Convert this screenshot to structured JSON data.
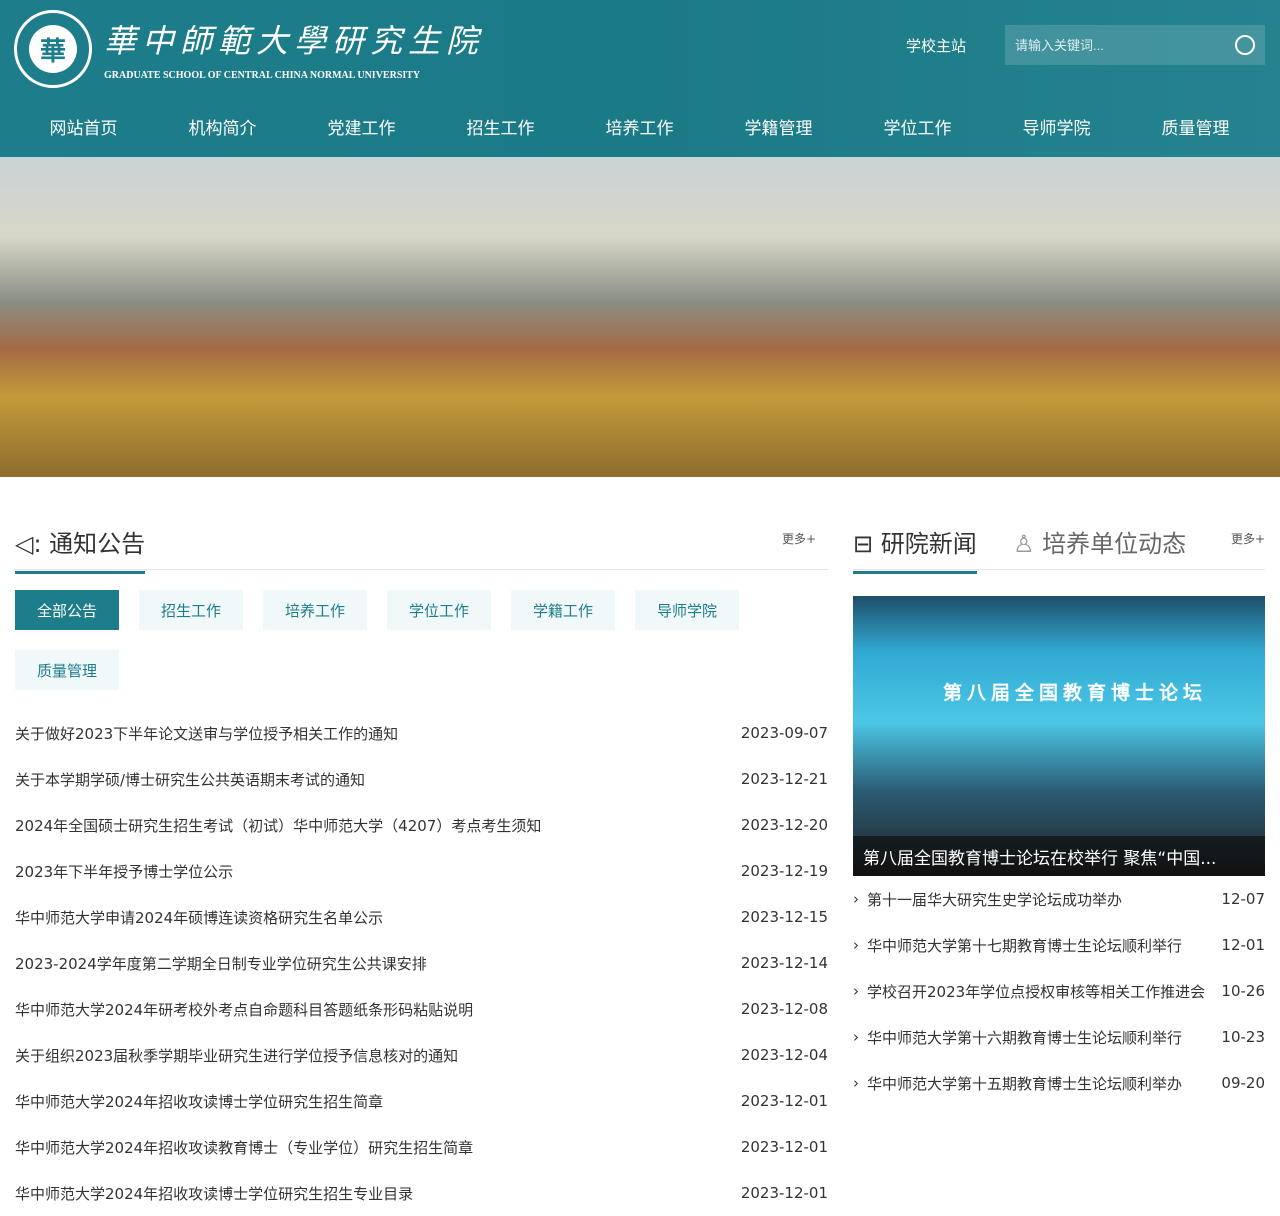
{
  "header": {
    "logo_text": "華",
    "title_cn": "華中師範大學研究生院",
    "title_en": "GRADUATE SCHOOL OF CENTRAL CHINA NORMAL UNIVERSITY",
    "school_link": "学校主站",
    "search_placeholder": "请输入关键词..."
  },
  "nav": [
    "网站首页",
    "机构简介",
    "党建工作",
    "招生工作",
    "培养工作",
    "学籍管理",
    "学位工作",
    "导师学院",
    "质量管理"
  ],
  "banner": {
    "slides": 5,
    "active": 4
  },
  "notices": {
    "title": "通知公告",
    "more": "更多+",
    "tabs": [
      "全部公告",
      "招生工作",
      "培养工作",
      "学位工作",
      "学籍工作",
      "导师学院",
      "质量管理"
    ],
    "items": [
      {
        "t": "关于做好2023下半年论文送审与学位授予相关工作的通知",
        "d": "2023-09-07"
      },
      {
        "t": "关于本学期学硕/博士研究生公共英语期末考试的通知",
        "d": "2023-12-21"
      },
      {
        "t": "2024年全国硕士研究生招生考试（初试）华中师范大学（4207）考点考生须知",
        "d": "2023-12-20"
      },
      {
        "t": "2023年下半年授予博士学位公示",
        "d": "2023-12-19"
      },
      {
        "t": "华中师范大学申请2024年硕博连读资格研究生名单公示",
        "d": "2023-12-15"
      },
      {
        "t": "2023-2024学年度第二学期全日制专业学位研究生公共课安排",
        "d": "2023-12-14"
      },
      {
        "t": "华中师范大学2024年研考校外考点自命题科目答题纸条形码粘贴说明",
        "d": "2023-12-08"
      },
      {
        "t": "关于组织2023届秋季学期毕业研究生进行学位授予信息核对的通知",
        "d": "2023-12-04"
      },
      {
        "t": "华中师范大学2024年招收攻读博士学位研究生招生简章",
        "d": "2023-12-01"
      },
      {
        "t": "华中师范大学2024年招收攻读教育博士（专业学位）研究生招生简章",
        "d": "2023-12-01"
      },
      {
        "t": "华中师范大学2024年招收攻读博士学位研究生招生专业目录",
        "d": "2023-12-01"
      }
    ]
  },
  "news": {
    "tab1": "研院新闻",
    "tab2": "培养单位动态",
    "more": "更多+",
    "image_banner": "第八届全国教育博士论坛",
    "caption": "第八届全国教育博士论坛在校举行 聚焦“中国...",
    "items": [
      {
        "t": "第十一届华大研究生史学论坛成功举办",
        "d": "12-07"
      },
      {
        "t": "华中师范大学第十七期教育博士生论坛顺利举行",
        "d": "12-01"
      },
      {
        "t": "学校召开2023年学位点授权审核等相关工作推进会",
        "d": "10-26"
      },
      {
        "t": "华中师范大学第十六期教育博士生论坛顺利举行",
        "d": "10-23"
      },
      {
        "t": "华中师范大学第十五期教育博士生论坛顺利举办",
        "d": "09-20"
      }
    ]
  }
}
